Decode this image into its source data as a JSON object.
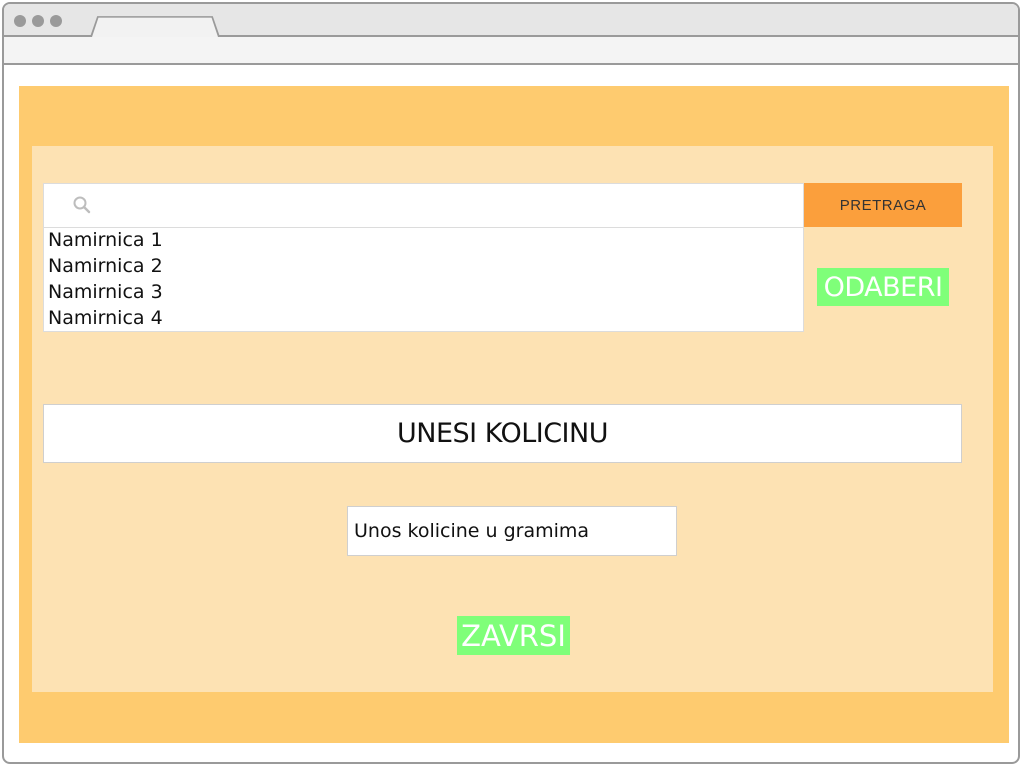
{
  "window": {
    "tab_title": ""
  },
  "search": {
    "placeholder": "",
    "button_label": "PRETRAGA",
    "icon": "search-icon"
  },
  "results": {
    "items": [
      {
        "label": "Namirnica 1"
      },
      {
        "label": "Namirnica 2"
      },
      {
        "label": "Namirnica 3"
      },
      {
        "label": "Namirnica 4"
      }
    ]
  },
  "select_button": {
    "label": "ODABERI"
  },
  "quantity": {
    "heading": "UNESI KOLICINU",
    "placeholder": "Unos kolicine u gramima",
    "value": ""
  },
  "finish_button": {
    "label": "ZAVRSI"
  },
  "colors": {
    "outer_panel": "#fecb6f",
    "inner_panel": "#fde2b3",
    "search_button": "#fb9f3c",
    "action_button": "#7fff79"
  }
}
